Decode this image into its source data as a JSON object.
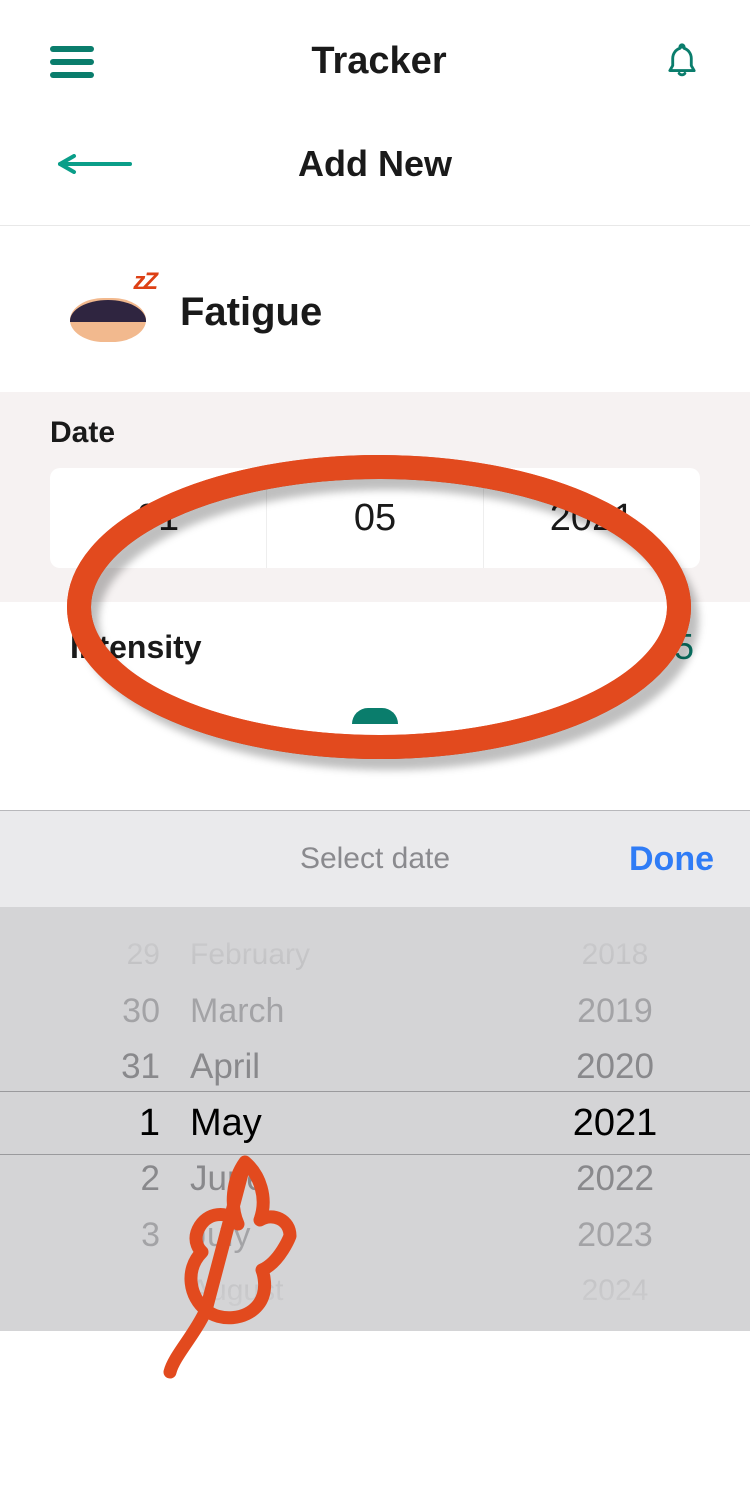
{
  "header": {
    "title": "Tracker"
  },
  "subheader": {
    "title": "Add New"
  },
  "symptom": {
    "name": "Fatigue",
    "zz": "zZ"
  },
  "date": {
    "label": "Date",
    "day": "01",
    "month": "05",
    "year": "2021"
  },
  "intensity": {
    "label": "Intensity",
    "value": "5"
  },
  "picker": {
    "title": "Select date",
    "done": "Done",
    "days": [
      "29",
      "30",
      "31",
      "1",
      "2",
      "3",
      ""
    ],
    "months": [
      "February",
      "March",
      "April",
      "May",
      "June",
      "July",
      "August"
    ],
    "years": [
      "2018",
      "2019",
      "2020",
      "2021",
      "2022",
      "2023",
      "2024"
    ],
    "selected_index": 3
  },
  "colors": {
    "accent": "#0a7d6c",
    "annotation": "#e24a1e",
    "done": "#2f7cf6"
  }
}
